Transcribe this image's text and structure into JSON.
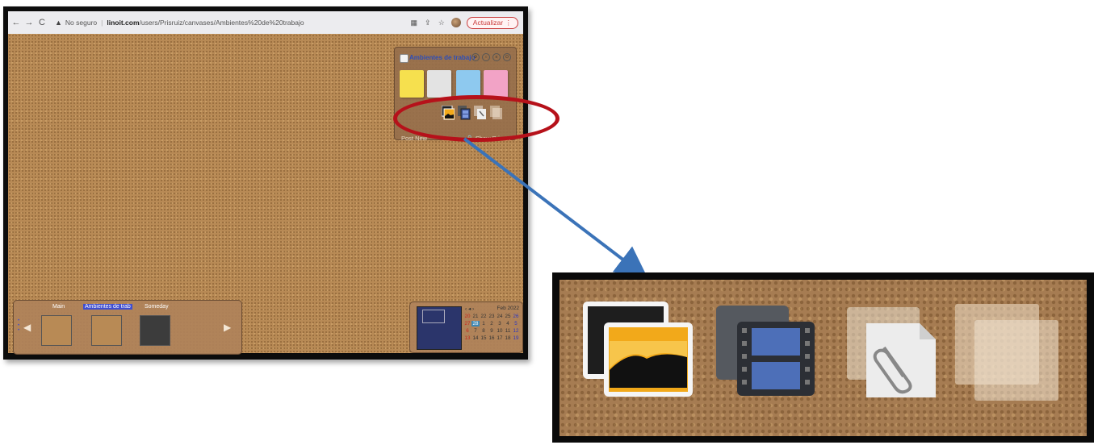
{
  "browser": {
    "nav_back": "←",
    "nav_forward": "→",
    "nav_reload": "C",
    "insecure_label": "No seguro",
    "url_host": "linoit.com",
    "url_path": "/users/Prisruiz/canvases/Ambientes%20de%20trabajo",
    "update_button": "Actualizar",
    "menu_icon": "⋮"
  },
  "panel": {
    "title": "Ambientes de trabajo",
    "sticky_colors": [
      "#f6e04e",
      "#e3e3e3",
      "#8ec9ef",
      "#f2a3c6"
    ],
    "tools": [
      "image-icon",
      "video-icon",
      "attachment-icon",
      "blank-icon"
    ],
    "post_new": "Post New",
    "show_private": "Show Private"
  },
  "canvases": {
    "items": [
      {
        "label": "Main",
        "active": false
      },
      {
        "label": "Ambientes de trab",
        "active": true
      },
      {
        "label": "Someday",
        "active": false
      }
    ]
  },
  "calendar": {
    "month": "Feb 2022",
    "rows": [
      [
        "20",
        "21",
        "22",
        "23",
        "24",
        "25",
        "26"
      ],
      [
        "27",
        "28",
        "1",
        "2",
        "3",
        "4",
        "5"
      ],
      [
        "6",
        "7",
        "8",
        "9",
        "10",
        "11",
        "12"
      ],
      [
        "13",
        "14",
        "15",
        "16",
        "17",
        "18",
        "19"
      ]
    ],
    "today": "28"
  },
  "annotation": {
    "highlight_color": "#b6111a",
    "arrow_color": "#3b73b8"
  }
}
